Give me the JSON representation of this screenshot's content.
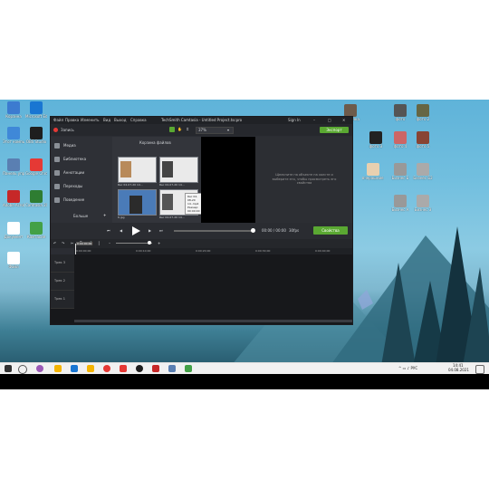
{
  "app": {
    "menu": [
      "Файл",
      "Правка",
      "Изменить",
      "Вид",
      "Выход",
      "Справка"
    ],
    "title": "TechSmith Camtasia - Untitled Project.tscpro",
    "signin": "Sign In",
    "record_label": "Запись",
    "zoom_value": "37%",
    "share_label": "Экспорт",
    "sidebar": [
      {
        "label": "Медиа"
      },
      {
        "label": "Библиотека"
      },
      {
        "label": "Аннотации"
      },
      {
        "label": "Переходы"
      },
      {
        "label": "Поведение"
      }
    ],
    "sidebar_more": "Больше",
    "bin_title": "Корзина файлов",
    "thumbs": [
      {
        "caption": "Rec 04-07-20 14..."
      },
      {
        "caption": "Rec 04-07-20 14..."
      },
      {
        "caption": "6.jpg"
      },
      {
        "caption": "Rec 04-07-20 14..."
      }
    ],
    "tooltip_line1": "Rec 04-08-20 14..mp4",
    "tooltip_line2": "Размер: 00:00:00",
    "props_text": "Щелкните на объекте на холсте и выберите его, чтобы просмотреть его свойства",
    "time_display": "00:00 / 00:00",
    "fps": "30fps",
    "properties_button": "Свойства",
    "timeline_ticks": [
      "0:00:00;00",
      "0:00:10;00",
      "0:00:20;00",
      "0:00:30;00",
      "0:00:40;00"
    ],
    "playhead_time": "0:00:00;00",
    "tracks": [
      "Трек 3",
      "Трек 2",
      "Трек 1"
    ]
  },
  "desktop": {
    "left_icons": [
      {
        "label": "Корзина",
        "color": "#3c7bd0"
      },
      {
        "label": "Microsoft Edge",
        "color": "#1976d2"
      },
      {
        "label": "Этот компьютер",
        "color": "#3f88d8"
      },
      {
        "label": "OBS Studio",
        "color": "#1e1e1e"
      },
      {
        "label": "Панель управления",
        "color": "#5a7fb2"
      },
      {
        "label": "Google Chrome",
        "color": "#e53935"
      },
      {
        "label": "Adobe Acrobat",
        "color": "#c62828"
      },
      {
        "label": "Camtasia 2019",
        "color": "#2e7d32"
      },
      {
        "label": "Документ",
        "color": "#ffffff"
      },
      {
        "label": "Камтасия",
        "color": "#43a047"
      },
      {
        "label": "Файл",
        "color": "#ffffff"
      }
    ],
    "right_icons": [
      {
        "label": "картинка",
        "color": "#6d5b4b"
      },
      {
        "label": "фото",
        "color": "#555"
      },
      {
        "label": "фото 2",
        "color": "#664"
      },
      {
        "label": "фото 3",
        "color": "#222"
      },
      {
        "label": "фото 4",
        "color": "#c66"
      },
      {
        "label": "фото 5",
        "color": "#843"
      },
      {
        "label": "вчерашние статьи",
        "color": "#e8d0b0"
      },
      {
        "label": "Бизнес Б",
        "color": "#999"
      },
      {
        "label": "Бизнес Б2",
        "color": "#aaa"
      },
      {
        "label": "Бизнес А",
        "color": "#999"
      },
      {
        "label": "Бизнес 3",
        "color": "#aaa"
      }
    ],
    "clock_time": "14:41",
    "clock_date": "04.08.2021"
  },
  "colors": {
    "accent": "#5aa832",
    "record_red": "#e53935"
  }
}
